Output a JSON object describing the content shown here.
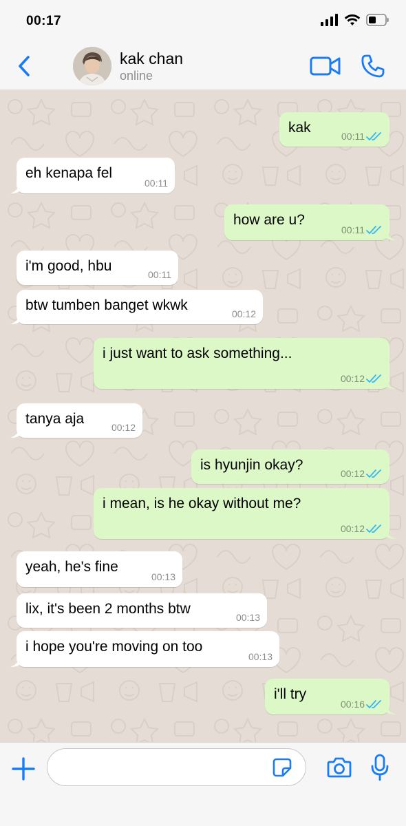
{
  "status_bar": {
    "time": "00:17"
  },
  "header": {
    "contact_name": "kak chan",
    "contact_status": "online"
  },
  "messages": [
    {
      "dir": "out",
      "text": "kak",
      "time": "00:11",
      "read": true
    },
    {
      "dir": "in",
      "text": "eh kenapa fel",
      "time": "00:11"
    },
    {
      "dir": "out",
      "text": "how are u?",
      "time": "00:11",
      "read": true
    },
    {
      "dir": "in",
      "text": "i'm good, hbu",
      "time": "00:11"
    },
    {
      "dir": "in",
      "text": "btw tumben banget wkwk",
      "time": "00:12"
    },
    {
      "dir": "out",
      "text": "i just want to ask something...",
      "time": "00:12",
      "read": true
    },
    {
      "dir": "in",
      "text": "tanya aja",
      "time": "00:12"
    },
    {
      "dir": "out",
      "text": "is hyunjin okay?",
      "time": "00:12",
      "read": true
    },
    {
      "dir": "out",
      "text": "i mean, is he okay without me?",
      "time": "00:12",
      "read": true
    },
    {
      "dir": "in",
      "text": "yeah, he's fine",
      "time": "00:13"
    },
    {
      "dir": "in",
      "text": "lix, it's been 2 months btw",
      "time": "00:13"
    },
    {
      "dir": "in",
      "text": "i hope you're moving on too",
      "time": "00:13"
    },
    {
      "dir": "out",
      "text": "i'll try",
      "time": "00:16",
      "read": true
    }
  ],
  "input_bar": {
    "value": "",
    "placeholder": ""
  },
  "colors": {
    "accent": "#1a7cf5",
    "outgoing_bubble": "#dcf8c6",
    "incoming_bubble": "#ffffff",
    "wallpaper": "#e5ddd5",
    "read_ticks": "#34b7f1"
  },
  "icons": {
    "back": "chevron-left-icon",
    "video": "video-camera-icon",
    "call": "phone-icon",
    "add": "plus-icon",
    "sticker": "sticker-icon",
    "camera": "camera-icon",
    "mic": "microphone-icon"
  }
}
